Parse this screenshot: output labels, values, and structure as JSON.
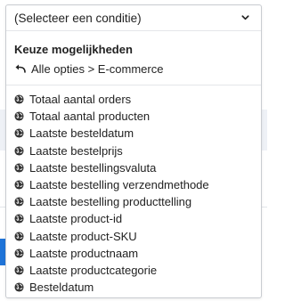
{
  "select": {
    "placeholder_label": "(Selecteer een conditie)",
    "chevron_icon": "chevron-down-icon"
  },
  "section": {
    "title": "Keuze mogelijkheden",
    "back_label": "Alle opties > E-commerce",
    "back_icon": "back-arrow-icon"
  },
  "options": [
    {
      "label": "Totaal aantal orders",
      "icon": "globe-icon"
    },
    {
      "label": "Totaal aantal producten",
      "icon": "globe-icon"
    },
    {
      "label": "Laatste besteldatum",
      "icon": "globe-icon"
    },
    {
      "label": "Laatste bestelprijs",
      "icon": "globe-icon"
    },
    {
      "label": "Laatste bestellingsvaluta",
      "icon": "globe-icon"
    },
    {
      "label": "Laatste bestelling verzendmethode",
      "icon": "globe-icon"
    },
    {
      "label": "Laatste bestelling producttelling",
      "icon": "globe-icon"
    },
    {
      "label": "Laatste product-id",
      "icon": "globe-icon"
    },
    {
      "label": "Laatste product-SKU",
      "icon": "globe-icon"
    },
    {
      "label": "Laatste productnaam",
      "icon": "globe-icon"
    },
    {
      "label": "Laatste productcategorie",
      "icon": "globe-icon"
    },
    {
      "label": "Besteldatum",
      "icon": "globe-icon"
    }
  ],
  "colors": {
    "accent_blue": "#1f74d8",
    "border": "#c9ccd1",
    "background_band": "#eef1f6"
  }
}
